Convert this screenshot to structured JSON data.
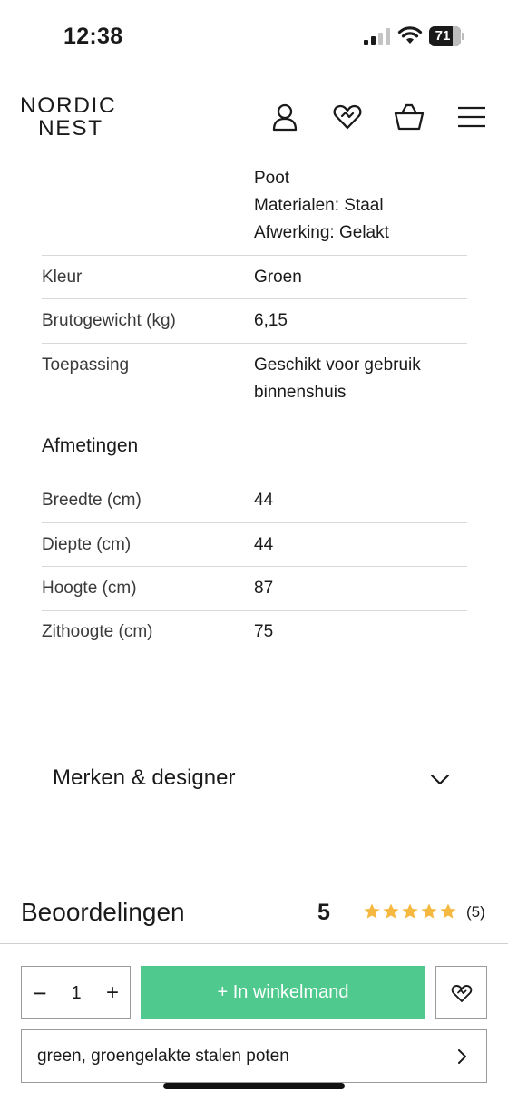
{
  "status_bar": {
    "time": "12:38",
    "battery": "71"
  },
  "header": {
    "logo_line1": "NORDIC",
    "logo_line2": "NEST",
    "icons": [
      "account-icon",
      "wishlist-icon",
      "basket-icon",
      "menu-icon"
    ]
  },
  "specs": {
    "leg": {
      "line1": "Poot",
      "line2": "Materialen: Staal",
      "line3": "Afwerking: Gelakt"
    },
    "rows": [
      {
        "key": "Kleur",
        "value": "Groen"
      },
      {
        "key": "Brutogewicht (kg)",
        "value": "6,15"
      },
      {
        "key": "Toepassing",
        "value_line1": "Geschikt voor gebruik",
        "value_line2": "binnenshuis"
      }
    ]
  },
  "dimensions": {
    "title": "Afmetingen",
    "rows": [
      {
        "key": "Breedte (cm)",
        "value": "44"
      },
      {
        "key": "Diepte (cm)",
        "value": "44"
      },
      {
        "key": "Hoogte (cm)",
        "value": "87"
      },
      {
        "key": "Zithoogte (cm)",
        "value": "75"
      }
    ]
  },
  "accordion": {
    "brands_label": "Merken & designer"
  },
  "reviews": {
    "title": "Beoordelingen",
    "score": "5",
    "stars": 5,
    "count": "(5)",
    "star_color": "#f5b942"
  },
  "purchase": {
    "quantity": "1",
    "minus": "−",
    "plus": "+",
    "add_to_cart": "+ In winkelmand",
    "variant": "green, groengelakte stalen poten",
    "accent_color": "#4fc98d"
  }
}
